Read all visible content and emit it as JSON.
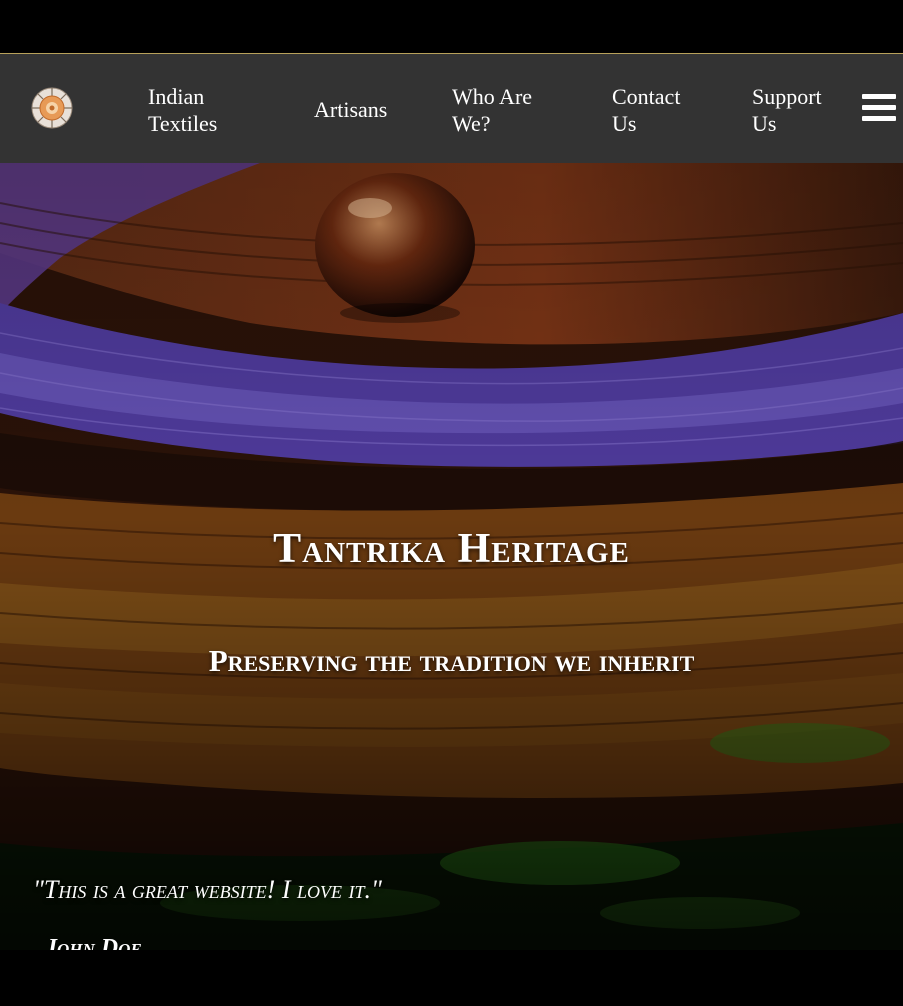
{
  "nav": {
    "logo": "mandala-logo",
    "items": [
      {
        "line1": "Indian",
        "line2": "Textiles"
      },
      {
        "line1": "Artisans",
        "line2": ""
      },
      {
        "line1": "Who Are",
        "line2": "We?"
      },
      {
        "line1": "Contact",
        "line2": "Us"
      },
      {
        "line1": "Support",
        "line2": "Us"
      }
    ],
    "menu_icon": "hamburger-menu-icon"
  },
  "hero": {
    "title": "Tantrika Heritage",
    "subtitle": "Preserving the tradition we inherit",
    "quote": "\"This is a great website! I love it.\"",
    "quote_author": "John Doe"
  },
  "colors": {
    "navbar_bg": "#333333",
    "nav_border": "#b8a15a",
    "text": "#ffffff"
  }
}
